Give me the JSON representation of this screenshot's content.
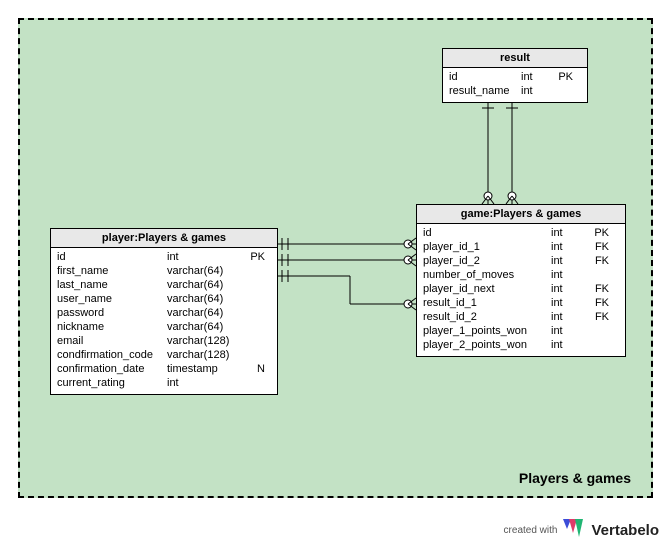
{
  "group_label": "Players & games",
  "entities": {
    "result": {
      "title": "result",
      "columns": [
        {
          "name": "id",
          "type": "int",
          "flag": "PK"
        },
        {
          "name": "result_name",
          "type": "int",
          "flag": ""
        }
      ]
    },
    "game": {
      "title": "game:Players & games",
      "columns": [
        {
          "name": "id",
          "type": "int",
          "flag": "PK"
        },
        {
          "name": "player_id_1",
          "type": "int",
          "flag": "FK"
        },
        {
          "name": "player_id_2",
          "type": "int",
          "flag": "FK"
        },
        {
          "name": "number_of_moves",
          "type": "int",
          "flag": ""
        },
        {
          "name": "player_id_next",
          "type": "int",
          "flag": "FK"
        },
        {
          "name": "result_id_1",
          "type": "int",
          "flag": "FK"
        },
        {
          "name": "result_id_2",
          "type": "int",
          "flag": "FK"
        },
        {
          "name": "player_1_points_won",
          "type": "int",
          "flag": ""
        },
        {
          "name": "player_2_points_won",
          "type": "int",
          "flag": ""
        }
      ]
    },
    "player": {
      "title": "player:Players & games",
      "columns": [
        {
          "name": "id",
          "type": "int",
          "flag": "PK"
        },
        {
          "name": "first_name",
          "type": "varchar(64)",
          "flag": ""
        },
        {
          "name": "last_name",
          "type": "varchar(64)",
          "flag": ""
        },
        {
          "name": "user_name",
          "type": "varchar(64)",
          "flag": ""
        },
        {
          "name": "password",
          "type": "varchar(64)",
          "flag": ""
        },
        {
          "name": "nickname",
          "type": "varchar(64)",
          "flag": ""
        },
        {
          "name": "email",
          "type": "varchar(128)",
          "flag": ""
        },
        {
          "name": "condfirmation_code",
          "type": "varchar(128)",
          "flag": ""
        },
        {
          "name": "confirmation_date",
          "type": "timestamp",
          "flag": "N"
        },
        {
          "name": "current_rating",
          "type": "int",
          "flag": ""
        }
      ]
    }
  },
  "footer": {
    "created_with": "created with",
    "brand": "Vertabelo"
  }
}
